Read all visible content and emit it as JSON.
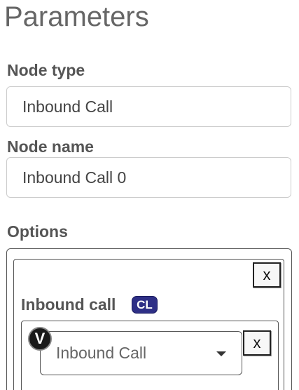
{
  "header": {
    "title": "Parameters"
  },
  "node_type": {
    "label": "Node type",
    "value": "Inbound Call"
  },
  "node_name": {
    "label": "Node name",
    "value": "Inbound Call 0"
  },
  "options": {
    "label": "Options",
    "remove_label": "x",
    "item": {
      "label": "Inbound call",
      "badge": "CL",
      "value_badge": "V",
      "select_value": "Inbound Call",
      "select_icon": "caret-down-icon",
      "remove_label": "x"
    }
  },
  "colors": {
    "badge_bg": "#2e2f86",
    "label_text": "#555555",
    "title_text": "#666666"
  }
}
